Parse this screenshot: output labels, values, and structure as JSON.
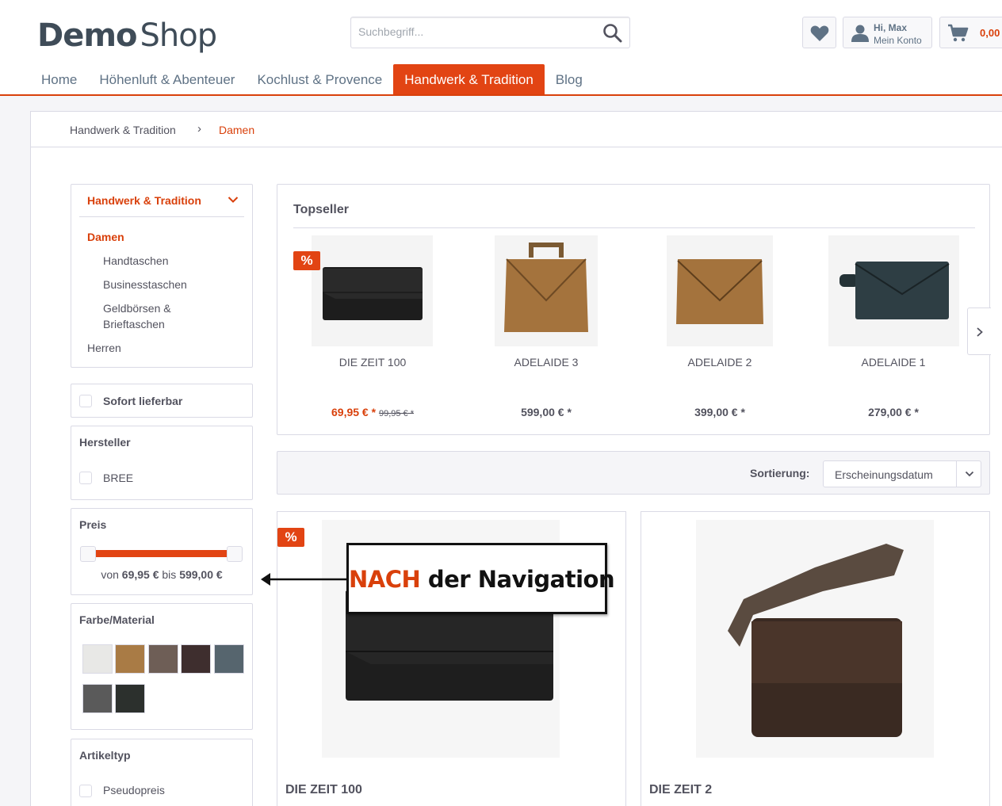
{
  "header": {
    "logo_demo": "Demo",
    "logo_shop": "Shop",
    "search_placeholder": "Suchbegriff...",
    "account_greeting": "Hi, Max",
    "account_label": "Mein Konto",
    "cart_amount": "0,00"
  },
  "nav": {
    "items": [
      "Home",
      "Höhenluft & Abenteuer",
      "Kochlust & Provence",
      "Handwerk & Tradition",
      "Blog"
    ],
    "active": "Handwerk & Tradition"
  },
  "breadcrumb": {
    "parent": "Handwerk & Tradition",
    "separator": "›",
    "current": "Damen"
  },
  "sidebar": {
    "category_head": "Handwerk & Tradition",
    "current": "Damen",
    "subcategories": [
      "Handtaschen",
      "Businesstaschen",
      "Geldbörsen &",
      "Brieftaschen"
    ],
    "other": "Herren",
    "immediate_label": "Sofort lieferbar",
    "manufacturer_title": "Hersteller",
    "manufacturer_option": "BREE",
    "price_title": "Preis",
    "price_from_label": "von",
    "price_min": "69,95 €",
    "price_to_label": "bis",
    "price_max": "599,00 €",
    "color_title": "Farbe/Material",
    "swatches": [
      "#e8e8e6",
      "#a97b45",
      "#6e5e56",
      "#3e2e2e",
      "#56656e",
      "#5a5a5a",
      "#2c302d"
    ],
    "type_title": "Artikeltyp",
    "type_option": "Pseudopreis"
  },
  "topseller": {
    "title": "Topseller",
    "badge": "%",
    "products": [
      {
        "name": "DIE ZEIT 100",
        "price": "69,95 € *",
        "old_price": "99,95 € *"
      },
      {
        "name": "ADELAIDE 3",
        "price": "599,00 € *"
      },
      {
        "name": "ADELAIDE 2",
        "price": "399,00 € *"
      },
      {
        "name": "ADELAIDE 1",
        "price": "279,00 € *"
      }
    ]
  },
  "sorting": {
    "label": "Sortierung:",
    "value": "Erscheinungsdatum"
  },
  "listing": {
    "badge": "%",
    "products": [
      {
        "name": "DIE ZEIT 100"
      },
      {
        "name": "DIE ZEIT 2"
      }
    ]
  },
  "annotation": {
    "highlight": "NACH",
    "rest": " der Navigation"
  }
}
